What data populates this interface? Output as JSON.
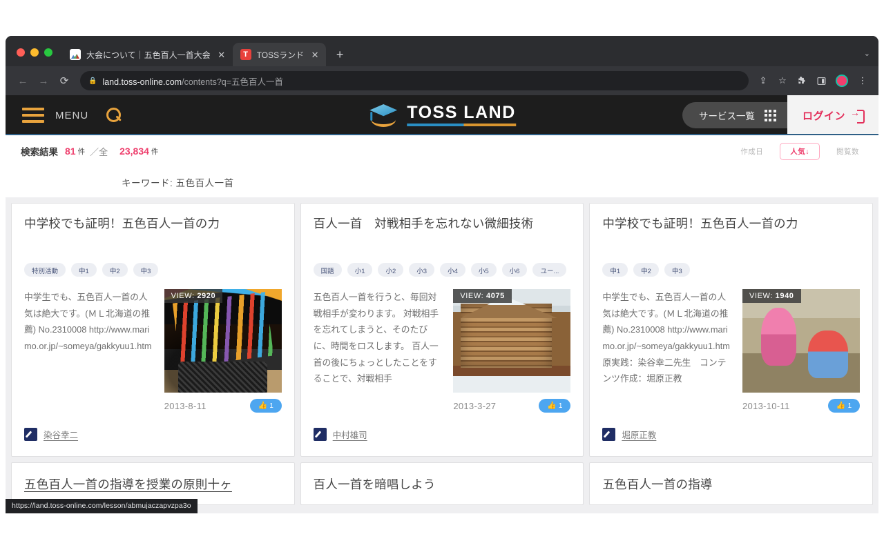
{
  "browser": {
    "tabs": [
      {
        "title": "大会について｜五色百人一首大会",
        "active": false,
        "favicon": "chart-favicon",
        "close_glyph": "✕"
      },
      {
        "title": "TOSSランド",
        "active": true,
        "favicon": "toss-favicon",
        "close_glyph": "✕"
      }
    ],
    "new_tab_glyph": "+",
    "tabstrip_chevron": "⌄",
    "nav": {
      "back": "←",
      "forward": "→",
      "reload": "⟳"
    },
    "omnibox": {
      "lock_glyph": "🔒",
      "domain": "land.toss-online.com",
      "path": "/contents?q=五色百人一首"
    },
    "toolbar_icons": [
      {
        "name": "share-icon",
        "glyph": "⇪"
      },
      {
        "name": "bookmark-star-icon",
        "glyph": "☆"
      },
      {
        "name": "extensions-icon",
        "glyph": "🧩"
      },
      {
        "name": "side-panel-icon",
        "glyph": "◨"
      },
      {
        "name": "profile-avatar",
        "glyph": ""
      },
      {
        "name": "chrome-menu-icon",
        "glyph": "⋮"
      }
    ],
    "status_url": "https://land.toss-online.com/lesson/abmujaczapvzpa3o"
  },
  "site_header": {
    "menu_label": "MENU",
    "brand_name": "TOSS LAND",
    "service_list_label": "サービス一覧",
    "login_label": "ログイン"
  },
  "result_bar": {
    "label": "検索結果",
    "count": "81",
    "unit": "件",
    "separator": "／全",
    "total": "23,834",
    "total_unit": "件",
    "sort": [
      {
        "label": "作成日",
        "active": false
      },
      {
        "label": "人気",
        "arrow": "↓",
        "active": true
      },
      {
        "label": "閲覧数",
        "active": false
      }
    ]
  },
  "keyword_row": {
    "text": "キーワード: 五色百人一首"
  },
  "cards": [
    {
      "title": "中学校でも証明！五色百人一首の力",
      "tags": [
        "特別活動",
        "中1",
        "中2",
        "中3"
      ],
      "body": "中学生でも、五色百人一首の人気は絶大です。(ＭＬ北海道の推薦) No.2310008\nhttp://www.marimo.or.jp/~someya/gakkyuu1.htm",
      "view_label": "VIEW:",
      "views": "2920",
      "date": "2013-8-11",
      "likes": "1",
      "like_glyph": "👍",
      "author": "染谷幸二",
      "photo": "photo-pencils"
    },
    {
      "title": "百人一首　対戦相手を忘れない微細技術",
      "tags": [
        "国語",
        "小1",
        "小2",
        "小3",
        "小4",
        "小5",
        "小6",
        "ユー..."
      ],
      "body": "五色百人一首を行うと、毎回対戦相手が変わります。\n対戦相手を忘れてしまうと、そのたびに、時間をロスします。\n百人一首の後にちょっとしたことをすることで、対戦相手",
      "view_label": "VIEW:",
      "views": "4075",
      "date": "2013-3-27",
      "likes": "1",
      "like_glyph": "👍",
      "author": "中村雄司",
      "photo": "photo-cabin"
    },
    {
      "title": "中学校でも証明！五色百人一首の力",
      "tags": [
        "中1",
        "中2",
        "中3"
      ],
      "body": "中学生でも、五色百人一首の人気は絶大です。(ＭＬ北海道の推薦) No.2310008\nhttp://www.marimo.or.jp/~someya/gakkyuu1.htm\n原実践：染谷幸二先生　コンテンツ作成：堀原正教",
      "view_label": "VIEW:",
      "views": "1940",
      "date": "2013-10-11",
      "likes": "1",
      "like_glyph": "👍",
      "author": "堀原正教",
      "photo": "photo-kids"
    }
  ],
  "cards_partial": [
    {
      "title": "五色百人一首の指導を授業の原則十ヶ",
      "hovered": true
    },
    {
      "title": "百人一首を暗唱しよう",
      "hovered": false
    },
    {
      "title": "五色百人一首の指導",
      "hovered": false
    }
  ]
}
